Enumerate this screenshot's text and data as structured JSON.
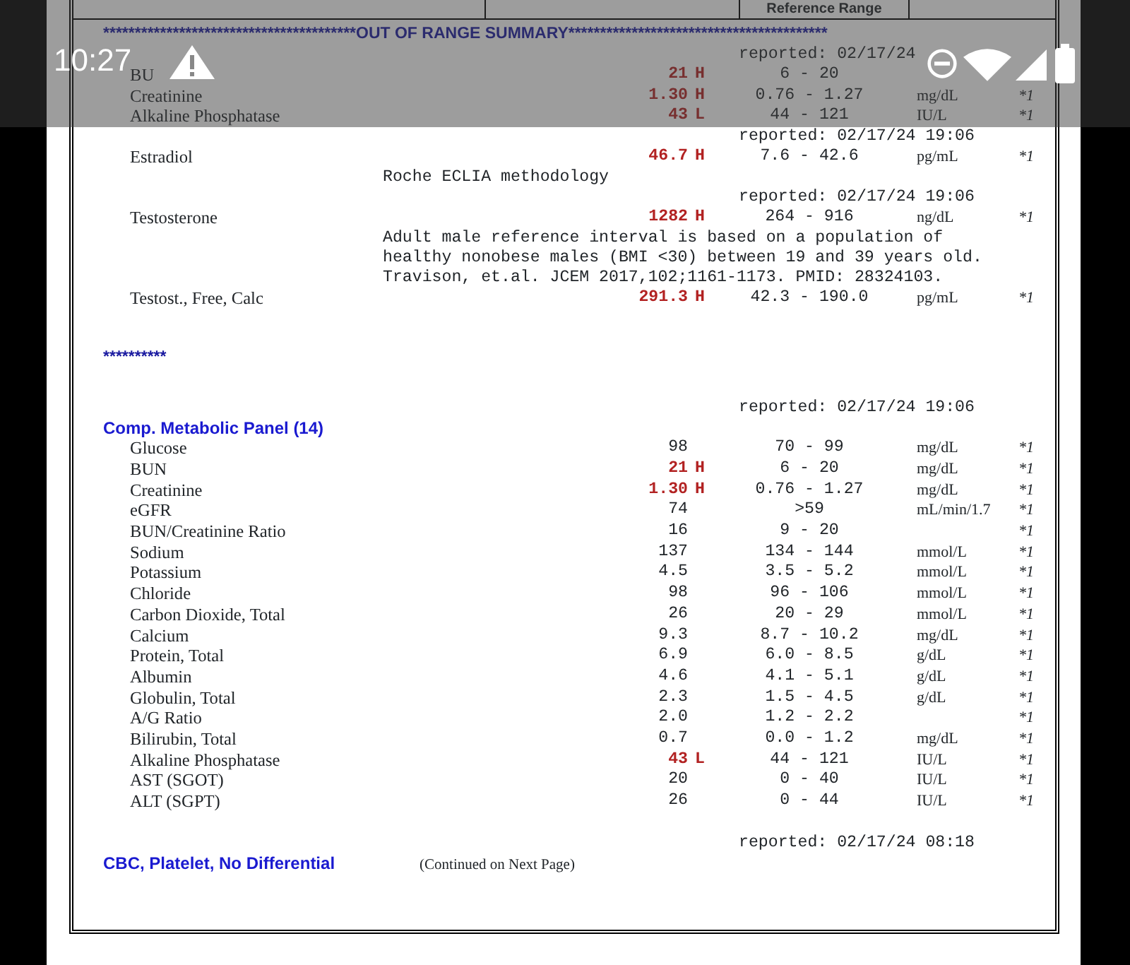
{
  "header_row": {
    "column_3": "Reference Range"
  },
  "out_of_range_summary": {
    "title": "****************************************OUT OF RANGE SUMMARY*****************************************",
    "items": [
      {
        "kind": "reported",
        "text": "reported: 02/17/24"
      },
      {
        "kind": "result",
        "name": "BU",
        "value": "21",
        "flag": "H",
        "range": "6 - 20"
      },
      {
        "kind": "result",
        "name": "Creatinine",
        "value": "1.30",
        "flag": "H",
        "range": "0.76 - 1.27",
        "unit": "mg/dL",
        "footnote": "*1"
      },
      {
        "kind": "result",
        "name": "Alkaline Phosphatase",
        "value": "43",
        "flag": "L",
        "range": "44 - 121",
        "unit": "IU/L",
        "footnote": "*1"
      },
      {
        "kind": "reported",
        "text": "reported: 02/17/24 19:06"
      },
      {
        "kind": "result",
        "name": "Estradiol",
        "value": "46.7",
        "flag": "H",
        "range": "7.6 - 42.6",
        "unit": "pg/mL",
        "footnote": "*1"
      },
      {
        "kind": "note",
        "text": "Roche ECLIA methodology"
      },
      {
        "kind": "reported",
        "text": "reported: 02/17/24 19:06"
      },
      {
        "kind": "result",
        "name": "Testosterone",
        "value": "1282",
        "flag": "H",
        "range": "264 - 916",
        "unit": "ng/dL",
        "footnote": "*1"
      },
      {
        "kind": "note",
        "text": "Adult male reference interval is based on a population of\nhealthy nonobese males (BMI <30) between 19 and 39 years old.\nTravison, et.al. JCEM 2017,102;1161-1173. PMID: 28324103."
      },
      {
        "kind": "result",
        "name": "Testost., Free, Calc",
        "value": "291.3",
        "flag": "H",
        "range": "42.3 - 190.0",
        "unit": "pg/mL",
        "footnote": "*1"
      }
    ]
  },
  "separator": "**********",
  "panels": [
    {
      "reported": "reported: 02/17/24 19:06",
      "title": "Comp. Metabolic Panel (14)",
      "results": [
        {
          "name": "Glucose",
          "value": "98",
          "range": "70 - 99",
          "unit": "mg/dL",
          "footnote": "*1"
        },
        {
          "name": "BUN",
          "value": "21",
          "flag": "H",
          "range": "6 - 20",
          "unit": "mg/dL",
          "footnote": "*1"
        },
        {
          "name": "Creatinine",
          "value": "1.30",
          "flag": "H",
          "range": "0.76 - 1.27",
          "unit": "mg/dL",
          "footnote": "*1"
        },
        {
          "name": "eGFR",
          "value": "74",
          "range": ">59",
          "unit": "mL/min/1.7",
          "footnote": "*1"
        },
        {
          "name": "BUN/Creatinine Ratio",
          "value": "16",
          "range": "9 - 20",
          "footnote": "*1"
        },
        {
          "name": "Sodium",
          "value": "137",
          "range": "134 - 144",
          "unit": "mmol/L",
          "footnote": "*1"
        },
        {
          "name": "Potassium",
          "value": "4.5",
          "range": "3.5 - 5.2",
          "unit": "mmol/L",
          "footnote": "*1"
        },
        {
          "name": "Chloride",
          "value": "98",
          "range": "96 - 106",
          "unit": "mmol/L",
          "footnote": "*1"
        },
        {
          "name": "Carbon Dioxide, Total",
          "value": "26",
          "range": "20 - 29",
          "unit": "mmol/L",
          "footnote": "*1"
        },
        {
          "name": "Calcium",
          "value": "9.3",
          "range": "8.7 - 10.2",
          "unit": "mg/dL",
          "footnote": "*1"
        },
        {
          "name": "Protein, Total",
          "value": "6.9",
          "range": "6.0 - 8.5",
          "unit": "g/dL",
          "footnote": "*1"
        },
        {
          "name": "Albumin",
          "value": "4.6",
          "range": "4.1 - 5.1",
          "unit": "g/dL",
          "footnote": "*1"
        },
        {
          "name": "Globulin, Total",
          "value": "2.3",
          "range": "1.5 - 4.5",
          "unit": "g/dL",
          "footnote": "*1"
        },
        {
          "name": "A/G Ratio",
          "value": "2.0",
          "range": "1.2 - 2.2",
          "footnote": "*1"
        },
        {
          "name": "Bilirubin, Total",
          "value": "0.7",
          "range": "0.0 - 1.2",
          "unit": "mg/dL",
          "footnote": "*1"
        },
        {
          "name": "Alkaline Phosphatase",
          "value": "43",
          "flag": "L",
          "range": "44 - 121",
          "unit": "IU/L",
          "footnote": "*1"
        },
        {
          "name": "AST (SGOT)",
          "value": "20",
          "range": "0 - 40",
          "unit": "IU/L",
          "footnote": "*1"
        },
        {
          "name": "ALT (SGPT)",
          "value": "26",
          "range": "0 - 44",
          "unit": "IU/L",
          "footnote": "*1"
        }
      ]
    },
    {
      "reported": "reported: 02/17/24 08:18",
      "title": "CBC, Platelet, No Differential",
      "note": "(Continued on Next Page)"
    }
  ],
  "status_bar": {
    "time": "10:27"
  }
}
